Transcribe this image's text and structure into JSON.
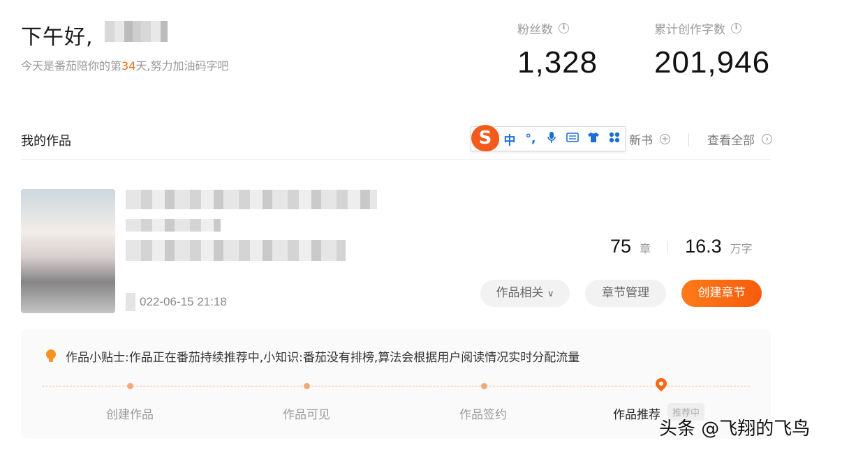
{
  "greeting": {
    "text": "下午好,",
    "days_prefix": "今天是番茄陪你的第",
    "days": "34",
    "days_suffix": "天,努力加油码字吧"
  },
  "stats": [
    {
      "label": "粉丝数",
      "value": "1,328"
    },
    {
      "label": "累计创作字数",
      "value": "201,946"
    }
  ],
  "works": {
    "title": "我的作品",
    "new_book": "新书",
    "view_all": "查看全部"
  },
  "ime_toolbar": {
    "logo": "S",
    "items": [
      "中",
      "°,",
      "🎤",
      "⌨",
      "👕",
      "▣"
    ]
  },
  "book": {
    "timestamp": "022-06-15 21:18",
    "chapters": "75",
    "chapters_unit": "章",
    "words": "16.3",
    "words_unit": "万字",
    "buttons": {
      "related": "作品相关",
      "manage": "章节管理",
      "create": "创建章节"
    }
  },
  "tips": {
    "text": "作品小贴士:作品正在番茄持续推荐中,小知识:番茄没有排榜,算法会根据用户阅读情况实时分配流量",
    "steps": [
      "创建作品",
      "作品可见",
      "作品签约",
      "作品推荐"
    ],
    "current_badge": "推荐中"
  },
  "watermark": "头条 @飞翔的飞鸟",
  "colors": {
    "accent": "#f56a16",
    "ime": "#1a6fd6"
  }
}
